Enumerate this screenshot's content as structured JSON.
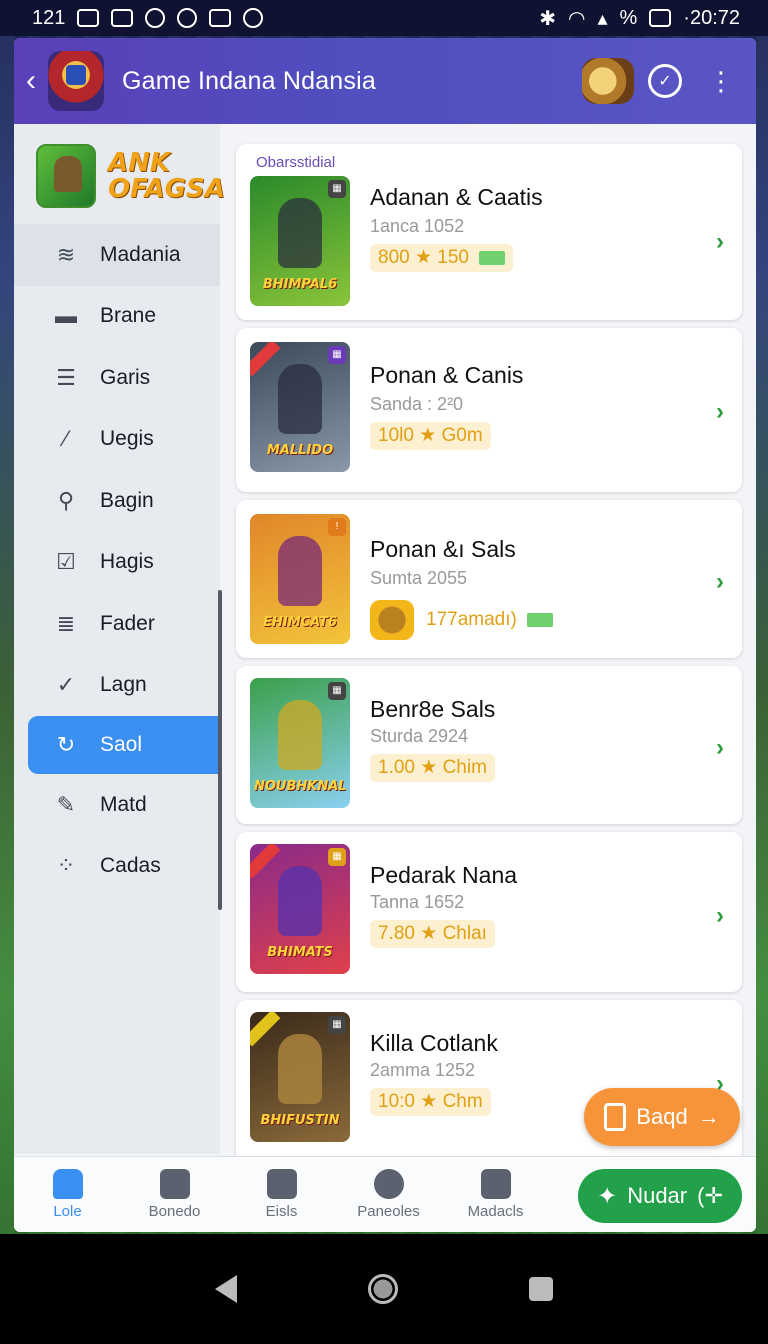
{
  "status_bar": {
    "left_text": "121",
    "time": "·20:72",
    "battery": "%"
  },
  "header": {
    "title": "Game Indana Ndansia"
  },
  "brand": {
    "text_line1": "ANK",
    "text_line2": "OFAGSA"
  },
  "sidebar": {
    "items": [
      {
        "label": "Madania",
        "icon": "menu-lines-icon"
      },
      {
        "label": "Brane",
        "icon": "stand-icon"
      },
      {
        "label": "Garis",
        "icon": "list-icon"
      },
      {
        "label": "Uegis",
        "icon": "link-icon"
      },
      {
        "label": "Bagin",
        "icon": "search-icon"
      },
      {
        "label": "Hagis",
        "icon": "edit-icon"
      },
      {
        "label": "Fader",
        "icon": "grid-icon"
      },
      {
        "label": "Lagn",
        "icon": "check-icon"
      },
      {
        "label": "Saol",
        "icon": "refresh-icon",
        "active": true
      },
      {
        "label": "Matd",
        "icon": "pen-icon"
      },
      {
        "label": "Cadas",
        "icon": "dots-icon"
      }
    ]
  },
  "list": {
    "section_label": "Obarsstidial",
    "cards": [
      {
        "title": "Adanan & Caatis",
        "subtitle": "1anca 1052",
        "meta": "800 ★ 150",
        "thumb_caption": "BHIMPAL6",
        "colors": [
          "#2a8a2a",
          "#8ac43a"
        ]
      },
      {
        "title": "Ponan & Canis",
        "subtitle": "Sanda : 2²0",
        "meta": "10l0 ★ G0m",
        "thumb_caption": "MALLIDO",
        "colors": [
          "#3a4a5a",
          "#8a98a8"
        ]
      },
      {
        "title": "Ponan &ı Sals",
        "subtitle": "Sumta 2055",
        "meta": "177amadı)",
        "thumb_caption": "EHIMCAT6",
        "colors": [
          "#e0862a",
          "#f3c43a"
        ]
      },
      {
        "title": "Benr8e Sals",
        "subtitle": "Sturda 2924",
        "meta": "1.00 ★ Chim",
        "thumb_caption": "NOUBHKNAL",
        "colors": [
          "#3aa04a",
          "#8ad0f0"
        ]
      },
      {
        "title": "Pedarak Nana",
        "subtitle": "Tanna 1652",
        "meta": "7.80 ★ Chlaı",
        "thumb_caption": "BHIMATS",
        "colors": [
          "#8a2a8a",
          "#e0404a"
        ]
      },
      {
        "title": "Killa Cotlank",
        "subtitle": "2amma 1252",
        "meta": "10:0 ★ Chm",
        "thumb_caption": "BHIFUSTIN",
        "colors": [
          "#3a2a1a",
          "#8a6a3a"
        ]
      }
    ]
  },
  "fab": {
    "label": "Baqd"
  },
  "bottom_nav": {
    "tabs": [
      {
        "label": "Lole",
        "icon": "home-icon"
      },
      {
        "label": "Bonedo",
        "icon": "castle-icon"
      },
      {
        "label": "Eisls",
        "icon": "tools-icon"
      },
      {
        "label": "Paneoles",
        "icon": "compass-icon"
      },
      {
        "label": "Madacls",
        "icon": "board-icon"
      }
    ],
    "cta": "Nudar"
  }
}
